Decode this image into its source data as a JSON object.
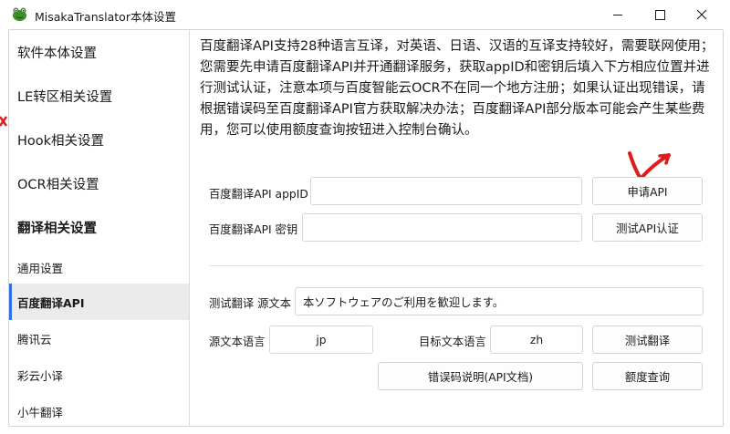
{
  "window": {
    "title": "MisakaTranslator本体设置",
    "icon": "frog-icon",
    "controls": [
      "minimize-icon",
      "maximize-icon",
      "close-icon"
    ]
  },
  "sidebar": {
    "items": [
      {
        "label": "软件本体设置"
      },
      {
        "label": "LE转区相关设置"
      },
      {
        "label": "Hook相关设置"
      },
      {
        "label": "OCR相关设置"
      },
      {
        "label": "翻译相关设置"
      },
      {
        "label": "通用设置"
      },
      {
        "label": "百度翻译API"
      },
      {
        "label": "腾讯云"
      },
      {
        "label": "彩云小译"
      },
      {
        "label": "小牛翻译"
      }
    ],
    "active_index": 6,
    "accent_color": "#2f6fdf"
  },
  "main": {
    "description": "百度翻译API支持28种语言互译，对英语、日语、汉语的互译支持较好，需要联网使用；您需要先申请百度翻译API并开通翻译服务，获取appID和密钥后填入下方相应位置并进行测试认证，注意本项与百度智能云OCR不在同一个地方注册；如果认证出现错误，请根据错误码至百度翻译API官方获取解决办法；百度翻译API部分版本可能会产生某些费用，您可以使用额度查询按钮进入控制台确认。",
    "appid": {
      "label": "百度翻译API appID",
      "value": ""
    },
    "secret": {
      "label": "百度翻译API 密钥",
      "value": ""
    },
    "apply_button": "申请API",
    "test_auth_button": "测试API认证",
    "test_source": {
      "label": "测试翻译 源文本",
      "value": "本ソフトウェアのご利用を歓迎します。"
    },
    "source_lang": {
      "label": "源文本语言",
      "value": "jp"
    },
    "target_lang": {
      "label": "目标文本语言",
      "value": "zh"
    },
    "test_translate_button": "测试翻译",
    "error_doc_button": "错误码说明(API文档)",
    "quota_button": "额度查询",
    "annotation": "red-hand-drawn-arrow"
  }
}
